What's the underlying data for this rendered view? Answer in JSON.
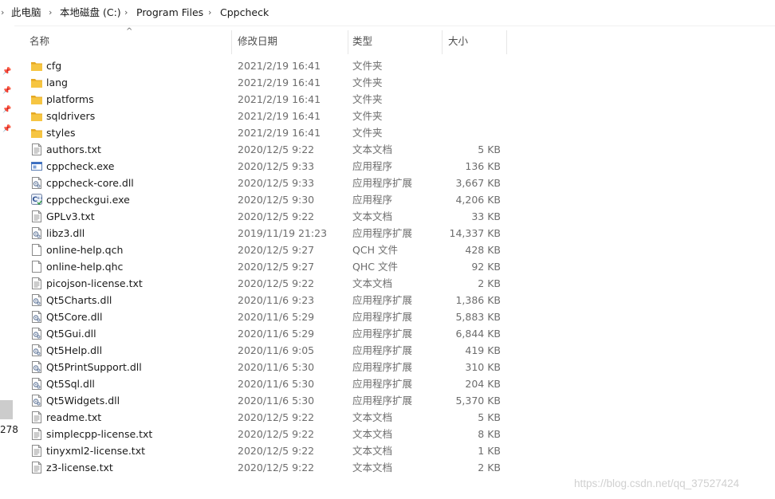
{
  "breadcrumb": {
    "items": [
      "此电脑",
      "本地磁盘 (C:)",
      "Program Files",
      "Cppcheck"
    ]
  },
  "columns": {
    "name": "名称",
    "date": "修改日期",
    "type": "类型",
    "size": "大小"
  },
  "nav": {
    "partial_label": "278"
  },
  "files": [
    {
      "name": "cfg",
      "date": "2021/2/19 16:41",
      "type": "文件夹",
      "size": "",
      "icon": "folder-icon"
    },
    {
      "name": "lang",
      "date": "2021/2/19 16:41",
      "type": "文件夹",
      "size": "",
      "icon": "folder-icon"
    },
    {
      "name": "platforms",
      "date": "2021/2/19 16:41",
      "type": "文件夹",
      "size": "",
      "icon": "folder-icon"
    },
    {
      "name": "sqldrivers",
      "date": "2021/2/19 16:41",
      "type": "文件夹",
      "size": "",
      "icon": "folder-icon"
    },
    {
      "name": "styles",
      "date": "2021/2/19 16:41",
      "type": "文件夹",
      "size": "",
      "icon": "folder-icon"
    },
    {
      "name": "authors.txt",
      "date": "2020/12/5 9:22",
      "type": "文本文档",
      "size": "5 KB",
      "icon": "text-file-icon"
    },
    {
      "name": "cppcheck.exe",
      "date": "2020/12/5 9:33",
      "type": "应用程序",
      "size": "136 KB",
      "icon": "exe-icon"
    },
    {
      "name": "cppcheck-core.dll",
      "date": "2020/12/5 9:33",
      "type": "应用程序扩展",
      "size": "3,667 KB",
      "icon": "dll-icon"
    },
    {
      "name": "cppcheckgui.exe",
      "date": "2020/12/5 9:30",
      "type": "应用程序",
      "size": "4,206 KB",
      "icon": "cppcheck-gui-icon"
    },
    {
      "name": "GPLv3.txt",
      "date": "2020/12/5 9:22",
      "type": "文本文档",
      "size": "33 KB",
      "icon": "text-file-icon"
    },
    {
      "name": "libz3.dll",
      "date": "2019/11/19 21:23",
      "type": "应用程序扩展",
      "size": "14,337 KB",
      "icon": "dll-icon"
    },
    {
      "name": "online-help.qch",
      "date": "2020/12/5 9:27",
      "type": "QCH 文件",
      "size": "428 KB",
      "icon": "blank-file-icon"
    },
    {
      "name": "online-help.qhc",
      "date": "2020/12/5 9:27",
      "type": "QHC 文件",
      "size": "92 KB",
      "icon": "blank-file-icon"
    },
    {
      "name": "picojson-license.txt",
      "date": "2020/12/5 9:22",
      "type": "文本文档",
      "size": "2 KB",
      "icon": "text-file-icon"
    },
    {
      "name": "Qt5Charts.dll",
      "date": "2020/11/6 9:23",
      "type": "应用程序扩展",
      "size": "1,386 KB",
      "icon": "dll-icon"
    },
    {
      "name": "Qt5Core.dll",
      "date": "2020/11/6 5:29",
      "type": "应用程序扩展",
      "size": "5,883 KB",
      "icon": "dll-icon"
    },
    {
      "name": "Qt5Gui.dll",
      "date": "2020/11/6 5:29",
      "type": "应用程序扩展",
      "size": "6,844 KB",
      "icon": "dll-icon"
    },
    {
      "name": "Qt5Help.dll",
      "date": "2020/11/6 9:05",
      "type": "应用程序扩展",
      "size": "419 KB",
      "icon": "dll-icon"
    },
    {
      "name": "Qt5PrintSupport.dll",
      "date": "2020/11/6 5:30",
      "type": "应用程序扩展",
      "size": "310 KB",
      "icon": "dll-icon"
    },
    {
      "name": "Qt5Sql.dll",
      "date": "2020/11/6 5:30",
      "type": "应用程序扩展",
      "size": "204 KB",
      "icon": "dll-icon"
    },
    {
      "name": "Qt5Widgets.dll",
      "date": "2020/11/6 5:30",
      "type": "应用程序扩展",
      "size": "5,370 KB",
      "icon": "dll-icon"
    },
    {
      "name": "readme.txt",
      "date": "2020/12/5 9:22",
      "type": "文本文档",
      "size": "5 KB",
      "icon": "text-file-icon"
    },
    {
      "name": "simplecpp-license.txt",
      "date": "2020/12/5 9:22",
      "type": "文本文档",
      "size": "8 KB",
      "icon": "text-file-icon"
    },
    {
      "name": "tinyxml2-license.txt",
      "date": "2020/12/5 9:22",
      "type": "文本文档",
      "size": "1 KB",
      "icon": "text-file-icon"
    },
    {
      "name": "z3-license.txt",
      "date": "2020/12/5 9:22",
      "type": "文本文档",
      "size": "2 KB",
      "icon": "text-file-icon"
    }
  ],
  "watermark": "https://blog.csdn.net/qq_37527424",
  "colors": {
    "folder": "#f6c542",
    "folder_dark": "#e5a823",
    "text_secondary": "#6d6d6d",
    "selection": "#cccccc"
  }
}
